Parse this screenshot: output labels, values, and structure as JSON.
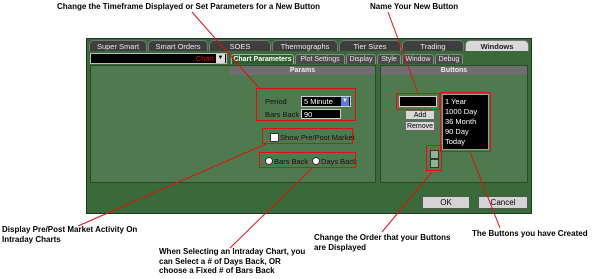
{
  "annotations": {
    "timeframe": "Change the Timeframe Displayed or Set Parameters for a New Button",
    "name_button": "Name Your New Button",
    "prepost": "Display Pre/Post Market Activity On Intraday Charts",
    "intraday": "When Selecting an Intraday Chart, you can Select a # of Days Back, OR choose a Fixed # of Bars Back",
    "order": "Change the Order that your Buttons are Displayed",
    "buttons_created": "The Buttons you have Created"
  },
  "tabs": [
    "Super Smart",
    "Smart Orders",
    "SOES",
    "Thermographs",
    "Tier Sizes",
    "Trading",
    "Windows"
  ],
  "active_tab": "Windows",
  "window_select": {
    "value": "Chart"
  },
  "subtabs": [
    "Chart Parameters",
    "Plot Settings",
    "Display",
    "Style",
    "Window",
    "Debug"
  ],
  "active_subtab": "Chart Parameters",
  "params": {
    "header": "Params",
    "period_label": "Period",
    "period_value": "5 Minute",
    "bars_back_label": "Bars Back",
    "bars_back_value": "90",
    "prepost_label": "Show Pre/Post Market",
    "radio_bars": "Bars Back",
    "radio_days": "Days Back"
  },
  "buttons_panel": {
    "header": "Buttons",
    "add": "Add",
    "remove": "Remove",
    "list": [
      "1 Year",
      "1000 Day",
      "36 Month",
      "90 Day",
      "Today"
    ]
  },
  "footer": {
    "ok": "OK",
    "cancel": "Cancel"
  },
  "colors": {
    "window_green": "#3a6a3a",
    "annotation_red": "#e01010"
  }
}
